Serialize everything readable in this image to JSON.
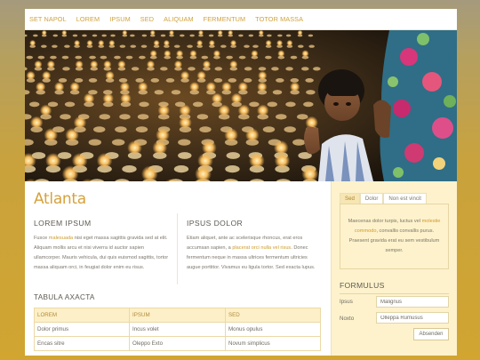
{
  "nav": {
    "items": [
      "SET NAPOL",
      "LOREM",
      "IPSUM",
      "SED",
      "ALIQUAM",
      "FERMENTUM",
      "TOTOR MASSA"
    ]
  },
  "hero": {
    "icon": "hero-photo"
  },
  "main": {
    "title": "Atlanta",
    "col1": {
      "heading": "LOREM IPSUM",
      "text_before": "Fusce ",
      "highlight": "malesuada",
      "text_after": " nisi eget massa sagittis gravida sed at elit. Aliquam mollis arcu et nisi viverra id auctor sapien ullamcorper. Mauris vehicula, dui quis euismod sagittis, tortor massa aliquam orci, in feugiat dolor enim eu risus."
    },
    "col2": {
      "heading": "IPSUS DOLOR",
      "text_before": "Etiam aliquet, ante ac scelerisque rhoncus, erat eros accumsan sapien, a ",
      "highlight": "placerat orci nulla vel risus",
      "text_after": ". Donec fermentum neque in massa ultrices fermentum ultricies augue porttitor. Vivamus eu ligula tortor. Sed exacta lupus."
    },
    "table": {
      "title": "TABULA AXACTA",
      "headers": [
        "LOREM",
        "IPSUM",
        "SED"
      ],
      "rows": [
        [
          "Dolor primus",
          "Incus volet",
          "Monus opulus"
        ],
        [
          "Encas sitre",
          "Oleppo Exto",
          "Novum simplicus"
        ]
      ]
    }
  },
  "sidebar": {
    "tabs": [
      "Sed",
      "Dolor",
      "Non est vincit"
    ],
    "active_tab": "Sed",
    "panel": {
      "text_before": "Maecenas dolor turpis, luctus vel ",
      "highlight": "molestie commodo",
      "text_after": ", convallis convallis purus. Praesent gravida erat eu sem vestibulum semper."
    },
    "form": {
      "title": "FORMULUS",
      "field1_label": "Ipsus",
      "field1_value": "Malignus",
      "field2_label": "Noxto",
      "field2_value": "Olleppa Rumusus",
      "submit_label": "Absenden"
    }
  },
  "colors": {
    "accent": "#d1a23b",
    "sidebar_bg": "#fdf2cc",
    "table_header_bg": "#fdf0c8",
    "page_bg_gradient_top": "#a59a7d",
    "page_bg_gradient_bottom": "#d1a530"
  }
}
